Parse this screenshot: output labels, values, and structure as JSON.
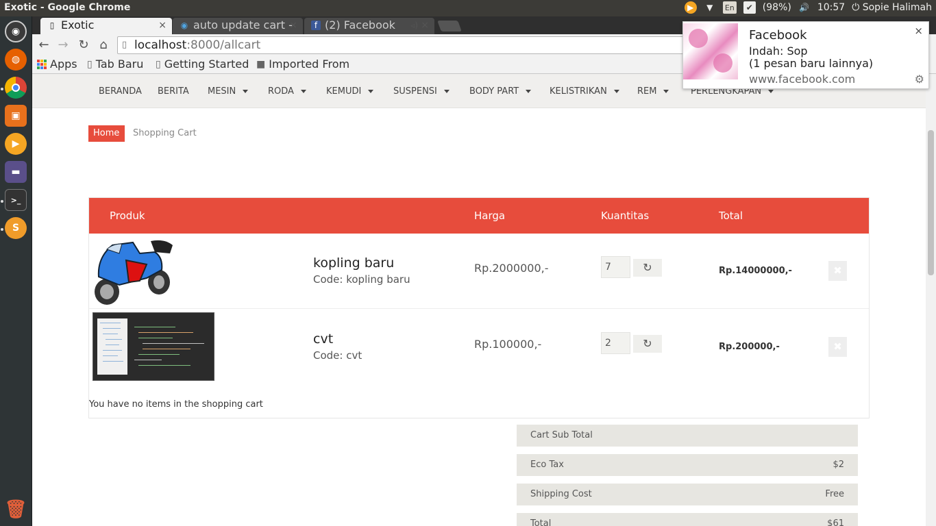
{
  "system": {
    "window_title": "Exotic - Google Chrome",
    "battery": "(98%)",
    "keyboard": "En",
    "time": "10:57",
    "user": "Sopie Halimah"
  },
  "launcher": {
    "items": [
      "ubuntu-dash-icon",
      "firefox-icon",
      "chrome-icon",
      "software-center-icon",
      "media-player-icon",
      "files-icon",
      "terminal-icon",
      "sublime-text-icon",
      "trash-icon"
    ]
  },
  "browser": {
    "tabs": [
      {
        "title": "Exotic",
        "favicon": "page-icon"
      },
      {
        "title": "auto update cart -",
        "favicon": "web-icon"
      },
      {
        "title": "(2) Facebook",
        "favicon": "facebook-icon"
      }
    ],
    "url_host": "localhost",
    "url_rest": ":8000/allcart",
    "bookmarks": [
      "Apps",
      "Tab Baru",
      "Getting Started",
      "Imported From"
    ]
  },
  "notification": {
    "title": "Facebook",
    "line1": "Indah: Sop",
    "line2": "(1 pesan baru lainnya)",
    "site": "www.facebook.com",
    "close": "×",
    "gear": "⚙"
  },
  "nav": {
    "items": [
      "BERANDA",
      "BERITA",
      "MESIN",
      "RODA",
      "KEMUDI",
      "SUSPENSI",
      "BODY PART",
      "KELISTRIKAN",
      "REM",
      "PERLENGKAPAN"
    ]
  },
  "breadcrumb": {
    "home": "Home",
    "current": "Shopping Cart"
  },
  "cart": {
    "headers": {
      "product": "Produk",
      "price": "Harga",
      "qty": "Kuantitas",
      "total": "Total"
    },
    "items": [
      {
        "name": "kopling baru",
        "code": "Code: kopling baru",
        "price": "Rp.2000000,-",
        "qty": "7",
        "total": "Rp.14000000,-"
      },
      {
        "name": "cvt",
        "code": "Code: cvt",
        "price": "Rp.100000,-",
        "qty": "2",
        "total": "Rp.200000,-"
      }
    ],
    "refresh_icon": "↻",
    "remove_icon": "✖",
    "empty_message": "You have no items in the shopping cart"
  },
  "summary": {
    "subtotal_label": "Cart Sub Total",
    "subtotal_value": "",
    "eco_label": "Eco Tax",
    "eco_value": "$2",
    "shipping_label": "Shipping Cost",
    "shipping_value": "Free",
    "total_label": "Total",
    "total_value": "$61"
  },
  "colors": {
    "accent": "#e74c3c",
    "summary_bg": "#e7e6e1"
  }
}
